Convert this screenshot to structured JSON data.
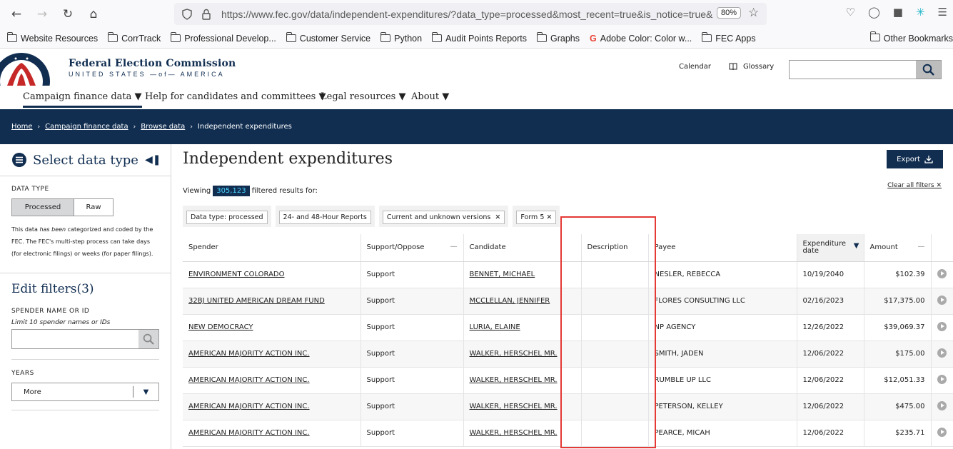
{
  "browser": {
    "url": "https://www.fec.gov/data/independent-expenditures/?data_type=processed&most_recent=true&is_notice=true&",
    "zoom": "80%"
  },
  "bookmarks": [
    {
      "label": "Website Resources",
      "icon": "folder-icon"
    },
    {
      "label": "CorrTrack",
      "icon": "folder-icon"
    },
    {
      "label": "Professional Develop...",
      "icon": "folder-icon"
    },
    {
      "label": "Customer Service",
      "icon": "folder-icon"
    },
    {
      "label": "Python",
      "icon": "folder-icon"
    },
    {
      "label": "Audit Points Reports",
      "icon": "folder-icon"
    },
    {
      "label": "Graphs",
      "icon": "folder-icon"
    },
    {
      "label": "Adobe Color: Color w...",
      "icon": "google-icon"
    },
    {
      "label": "FEC Apps",
      "icon": "folder-icon"
    }
  ],
  "bookmarks_other": "Other Bookmarks",
  "header": {
    "brand_title": "Federal Election Commission",
    "brand_subtitle": "UNITED STATES —of— AMERICA",
    "calendar": "Calendar",
    "glossary": "Glossary"
  },
  "nav": [
    "Campaign finance data",
    "Help for candidates and committees",
    "Legal resources",
    "About"
  ],
  "breadcrumbs": [
    "Home",
    "Campaign finance data",
    "Browse data",
    "Independent expenditures"
  ],
  "sidebar": {
    "title": "Select data type",
    "data_type_label": "DATA TYPE",
    "processed": "Processed",
    "raw": "Raw",
    "note_1": "This data ",
    "note_em": "has been",
    "note_2": " categorized and coded by the FEC. The FEC's multi-step process can take days (for electronic filings) or weeks (for paper filings).",
    "edit_filters": "Edit filters",
    "edit_filters_count": "(3)",
    "spender_label": "SPENDER NAME OR ID",
    "spender_hint": "Limit 10 spender names or IDs",
    "years_label": "YEARS",
    "years_value": "More"
  },
  "main": {
    "title": "Independent expenditures",
    "export": "Export",
    "viewing_prefix": "Viewing",
    "count": "305,123",
    "viewing_suffix": "filtered results for:",
    "clear_all": "Clear all filters",
    "chips": [
      "Data type: processed",
      "24- and 48-Hour Reports",
      "Current and unknown versions",
      "Form 5"
    ],
    "columns": [
      "Spender",
      "Support/Oppose",
      "Candidate",
      "Description",
      "Payee",
      "Expenditure date",
      "Amount"
    ],
    "rows": [
      {
        "spender": "ENVIRONMENT COLORADO",
        "support": "Support",
        "candidate": "BENNET, MICHAEL",
        "description": "",
        "payee": "NESLER, REBECCA",
        "date": "10/19/2040",
        "amount": "$102.39"
      },
      {
        "spender": "32BJ UNITED AMERICAN DREAM FUND",
        "support": "Support",
        "candidate": "MCCLELLAN, JENNIFER",
        "description": "",
        "payee": "FLORES CONSULTING LLC",
        "date": "02/16/2023",
        "amount": "$17,375.00"
      },
      {
        "spender": "NEW DEMOCRACY",
        "support": "Support",
        "candidate": "LURIA, ELAINE",
        "description": "",
        "payee": "NP AGENCY",
        "date": "12/26/2022",
        "amount": "$39,069.37"
      },
      {
        "spender": "AMERICAN MAJORITY ACTION INC.",
        "support": "Support",
        "candidate": "WALKER, HERSCHEL MR.",
        "description": "",
        "payee": "SMITH, JADEN",
        "date": "12/06/2022",
        "amount": "$175.00"
      },
      {
        "spender": "AMERICAN MAJORITY ACTION INC.",
        "support": "Support",
        "candidate": "WALKER, HERSCHEL MR.",
        "description": "",
        "payee": "RUMBLE UP LLC",
        "date": "12/06/2022",
        "amount": "$12,051.33"
      },
      {
        "spender": "AMERICAN MAJORITY ACTION INC.",
        "support": "Support",
        "candidate": "WALKER, HERSCHEL MR.",
        "description": "",
        "payee": "PETERSON, KELLEY",
        "date": "12/06/2022",
        "amount": "$475.00"
      },
      {
        "spender": "AMERICAN MAJORITY ACTION INC.",
        "support": "Support",
        "candidate": "WALKER, HERSCHEL MR.",
        "description": "",
        "payee": "PEARCE, MICAH",
        "date": "12/06/2022",
        "amount": "$235.71"
      }
    ]
  },
  "colors": {
    "navy": "#112e51",
    "accent": "#4ad2ff",
    "highlight": "#e53935"
  }
}
